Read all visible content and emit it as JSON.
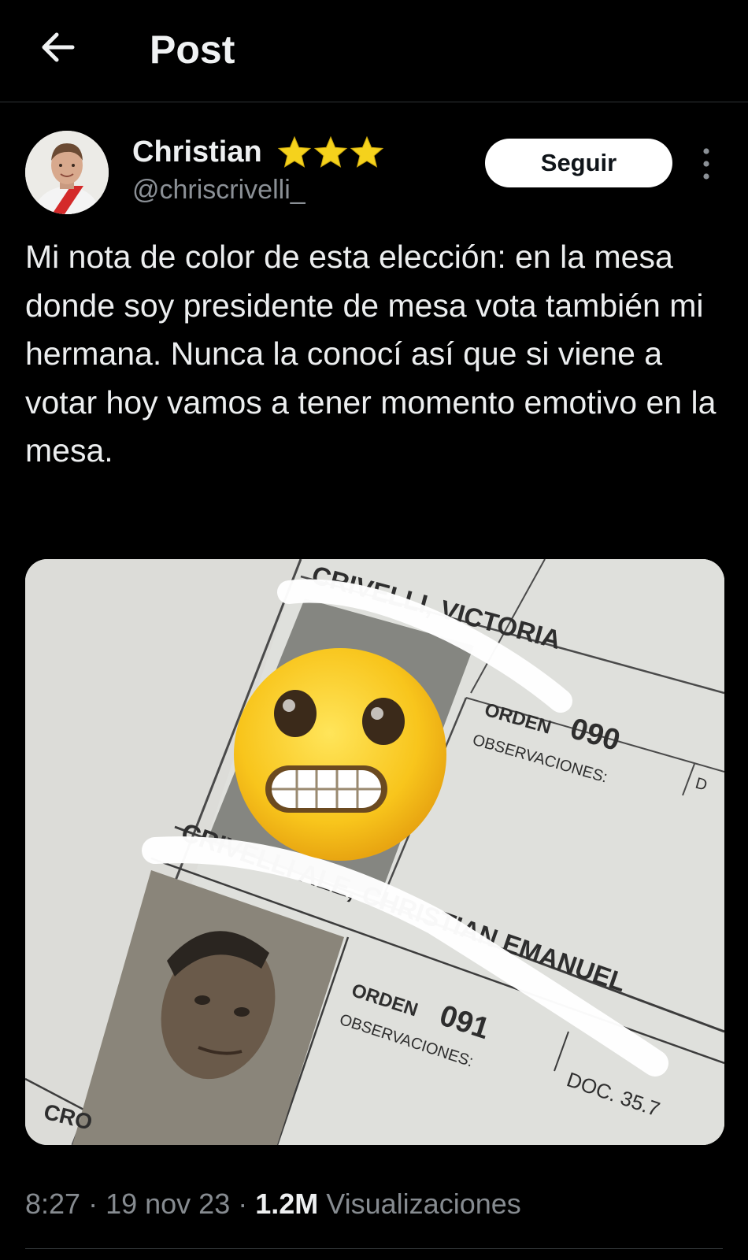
{
  "header": {
    "title": "Post",
    "back_icon": "arrow-left-icon"
  },
  "author": {
    "name": "Christian",
    "badge": "★★★",
    "handle": "@chriscrivelli_",
    "follow_label": "Seguir",
    "more_icon": "more-vertical-icon"
  },
  "post": {
    "text": "Mi nota de color de esta elección: en la mesa donde soy presidente de mesa vota también mi hermana. Nunca la conocí así que si viene a votar hoy vamos a tener momento emotivo en la mesa."
  },
  "media": {
    "name1": "CRIVELLI, VICTORIA",
    "orden_label_1": "ORDEN",
    "orden_num_1": "090",
    "obs_label_1": "OBSERVACIONES:",
    "doc_fragment_1": "D",
    "name2": "CRIVELLI ALE, CHRISTIAN EMANUEL",
    "orden_label_2": "ORDEN",
    "orden_num_2": "091",
    "obs_label_2": "OBSERVACIONES:",
    "doc_label_2": "DOC. 35.7",
    "next_name_fragment": "CRO",
    "emoji": "😬"
  },
  "meta": {
    "time": "8:27",
    "separator": " · ",
    "date": "19 nov 23",
    "views_count": "1.2M",
    "views_label": "Visualizaciones"
  },
  "colors": {
    "background": "#000000",
    "follow_button": "#ffffff",
    "star": "#f5d21c",
    "muted_text": "#868b90"
  }
}
